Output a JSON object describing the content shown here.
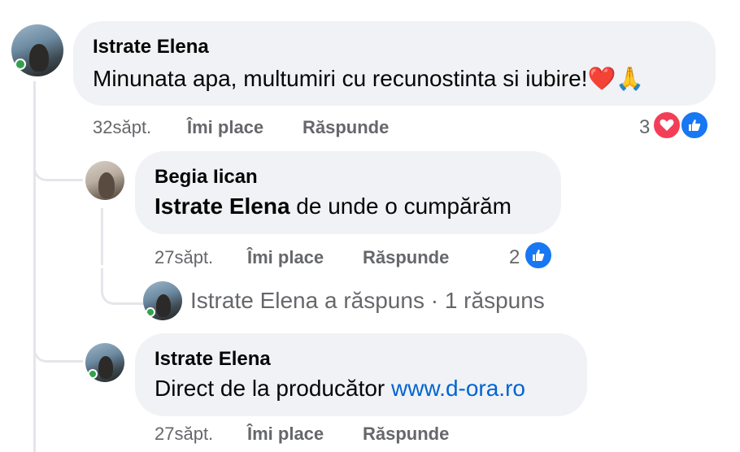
{
  "comments": [
    {
      "author": "Istrate Elena",
      "text": "Minunata apa, multumiri cu recunostinta si iubire!❤️🙏",
      "time": "32săpt.",
      "like_label": "Îmi place",
      "reply_label": "Răspunde",
      "reaction_count": "3",
      "reactions": [
        "heart-icon",
        "like-icon"
      ]
    },
    {
      "author": "Begia Iican",
      "mention": "Istrate Elena",
      "text": " de unde o cumpărăm",
      "time": "27săpt.",
      "like_label": "Îmi place",
      "reply_label": "Răspunde",
      "reaction_count": "2",
      "reactions": [
        "like-icon"
      ]
    },
    {
      "author": "Istrate Elena",
      "text": "Direct de la producător ",
      "link": "www.d-ora.ro",
      "time": "27săpt.",
      "like_label": "Îmi place",
      "reply_label": "Răspunde"
    }
  ],
  "reply_summary": {
    "text": "Istrate Elena a răspuns · 1 răspuns"
  },
  "colors": {
    "bubble": "#f0f2f5",
    "meta": "#65676b",
    "link": "#0064d1",
    "heart": "#f33e58",
    "like": "#1877f2"
  }
}
